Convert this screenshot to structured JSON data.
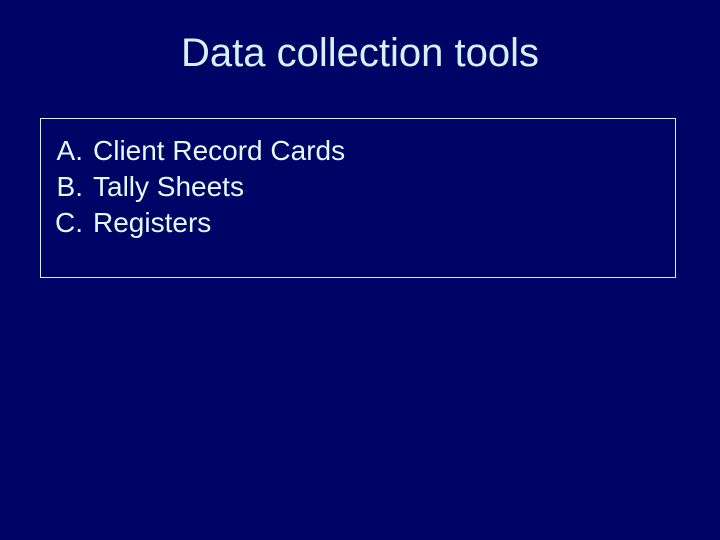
{
  "title": "Data collection tools",
  "items": [
    {
      "marker": "A.",
      "label": "Client Record Cards"
    },
    {
      "marker": "B.",
      "label": "Tally Sheets"
    },
    {
      "marker": "C.",
      "label": "Registers"
    }
  ]
}
